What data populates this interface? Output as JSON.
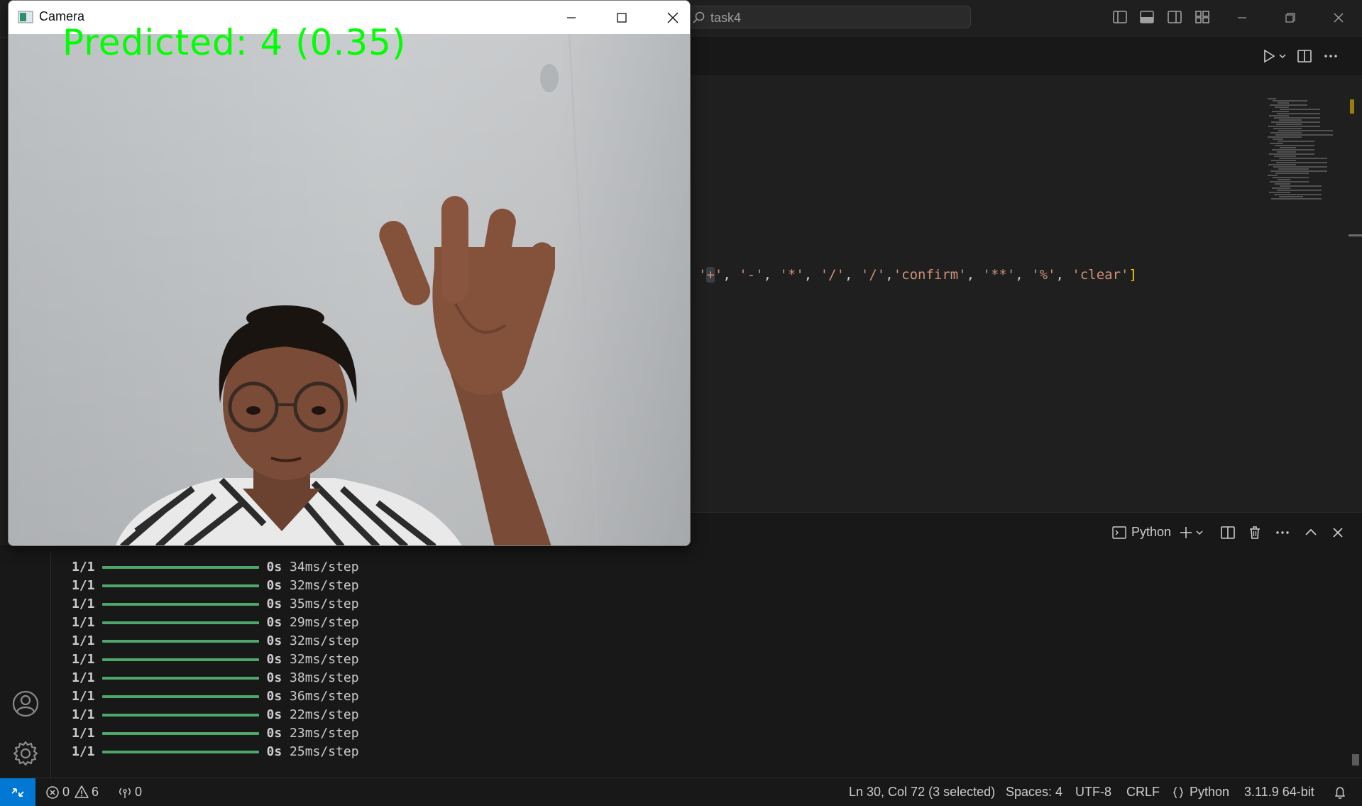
{
  "titlebar": {
    "search_text": "task4"
  },
  "editor": {
    "code_tokens": [
      {
        "t": "'",
        "c": "str"
      },
      {
        "t": "+",
        "c": "sel"
      },
      {
        "t": "'",
        "c": "str"
      },
      {
        "t": ", ",
        "c": "punc"
      },
      {
        "t": "'-'",
        "c": "str"
      },
      {
        "t": ", ",
        "c": "punc"
      },
      {
        "t": "'*'",
        "c": "str"
      },
      {
        "t": ", ",
        "c": "punc"
      },
      {
        "t": "'/'",
        "c": "str"
      },
      {
        "t": ", ",
        "c": "punc"
      },
      {
        "t": "'/'",
        "c": "str"
      },
      {
        "t": ",",
        "c": "punc"
      },
      {
        "t": "'confirm'",
        "c": "str"
      },
      {
        "t": ", ",
        "c": "punc"
      },
      {
        "t": "'**'",
        "c": "str"
      },
      {
        "t": ", ",
        "c": "punc"
      },
      {
        "t": "'%'",
        "c": "str"
      },
      {
        "t": ", ",
        "c": "punc"
      },
      {
        "t": "'clear'",
        "c": "str"
      },
      {
        "t": "]",
        "c": "brk"
      }
    ]
  },
  "panel": {
    "terminal_profile_label": "Python"
  },
  "terminal": {
    "lines": [
      {
        "frac": "1/1",
        "time": "0s",
        "step": "34ms/step"
      },
      {
        "frac": "1/1",
        "time": "0s",
        "step": "32ms/step"
      },
      {
        "frac": "1/1",
        "time": "0s",
        "step": "35ms/step"
      },
      {
        "frac": "1/1",
        "time": "0s",
        "step": "29ms/step"
      },
      {
        "frac": "1/1",
        "time": "0s",
        "step": "32ms/step"
      },
      {
        "frac": "1/1",
        "time": "0s",
        "step": "32ms/step"
      },
      {
        "frac": "1/1",
        "time": "0s",
        "step": "38ms/step"
      },
      {
        "frac": "1/1",
        "time": "0s",
        "step": "36ms/step"
      },
      {
        "frac": "1/1",
        "time": "0s",
        "step": "22ms/step"
      },
      {
        "frac": "1/1",
        "time": "0s",
        "step": "23ms/step"
      },
      {
        "frac": "1/1",
        "time": "0s",
        "step": "25ms/step"
      }
    ]
  },
  "statusbar": {
    "errors": "0",
    "warnings": "6",
    "ports": "0",
    "cursor": "Ln 30, Col 72 (3 selected)",
    "spaces": "Spaces: 4",
    "encoding": "UTF-8",
    "eol": "CRLF",
    "language": "Python",
    "interpreter": "3.11.9 64-bit",
    "remote_color": "#0078d4"
  },
  "camera_window": {
    "title": "Camera",
    "prediction": "Predicted: 4 (0.35)",
    "prediction_color": "#00ff00"
  }
}
